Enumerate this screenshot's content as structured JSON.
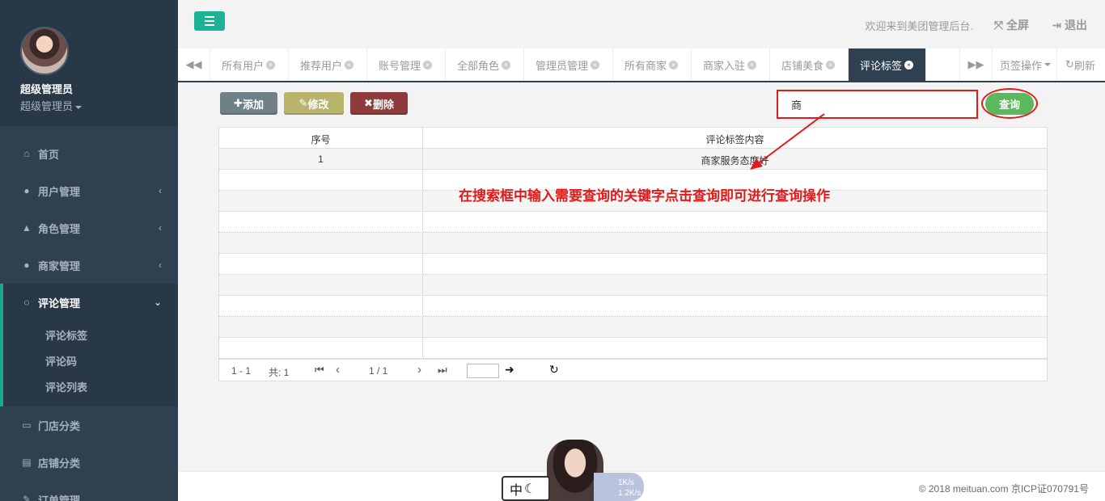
{
  "sidebar": {
    "user_name": "超级管理员",
    "user_role": "超级管理员",
    "items": [
      {
        "label": "首页",
        "icon": "home-icon"
      },
      {
        "label": "用户管理",
        "icon": "user-icon"
      },
      {
        "label": "角色管理",
        "icon": "flask-icon"
      },
      {
        "label": "商家管理",
        "icon": "user-plus-icon"
      },
      {
        "label": "评论管理",
        "icon": "comment-icon"
      },
      {
        "label": "门店分类",
        "icon": "desktop-icon"
      },
      {
        "label": "店铺分类",
        "icon": "list-icon"
      },
      {
        "label": "订单管理",
        "icon": "edit-icon"
      }
    ],
    "submenu": [
      "评论标签",
      "评论码",
      "评论列表"
    ]
  },
  "header": {
    "welcome": "欢迎来到美团管理后台.",
    "fullscreen": "全屏",
    "logout": "退出"
  },
  "tabs": {
    "items": [
      "所有用户",
      "推荐用户",
      "账号管理",
      "全部角色",
      "管理员管理",
      "所有商家",
      "商家入驻",
      "店铺美食",
      "评论标签"
    ],
    "active": "评论标签",
    "page_ops": "页签操作",
    "refresh": "刷新"
  },
  "toolbar": {
    "add": "添加",
    "edit": "修改",
    "delete": "删除"
  },
  "search": {
    "value": "商",
    "button": "查询"
  },
  "table": {
    "headers": [
      "序号",
      "评论标签内容"
    ],
    "rows": [
      [
        "1",
        "商家服务态度好"
      ]
    ]
  },
  "pager": {
    "range": "1 - 1",
    "total": "共: 1",
    "pages": "1 / 1"
  },
  "annotation": "在搜索框中输入需要查询的关键字点击查询即可进行查询操作",
  "footer": {
    "copyright": "© 2018 meituan.com 京ICP证070791号"
  },
  "taskbar": {
    "ime": "中",
    "up_speed": "1K/s",
    "down_speed": "1.2K/s"
  },
  "colors": {
    "sidebar": "#2f4050",
    "accent": "#1ab394",
    "annotation": "#e01b1b",
    "query_button": "#5cb85c"
  }
}
